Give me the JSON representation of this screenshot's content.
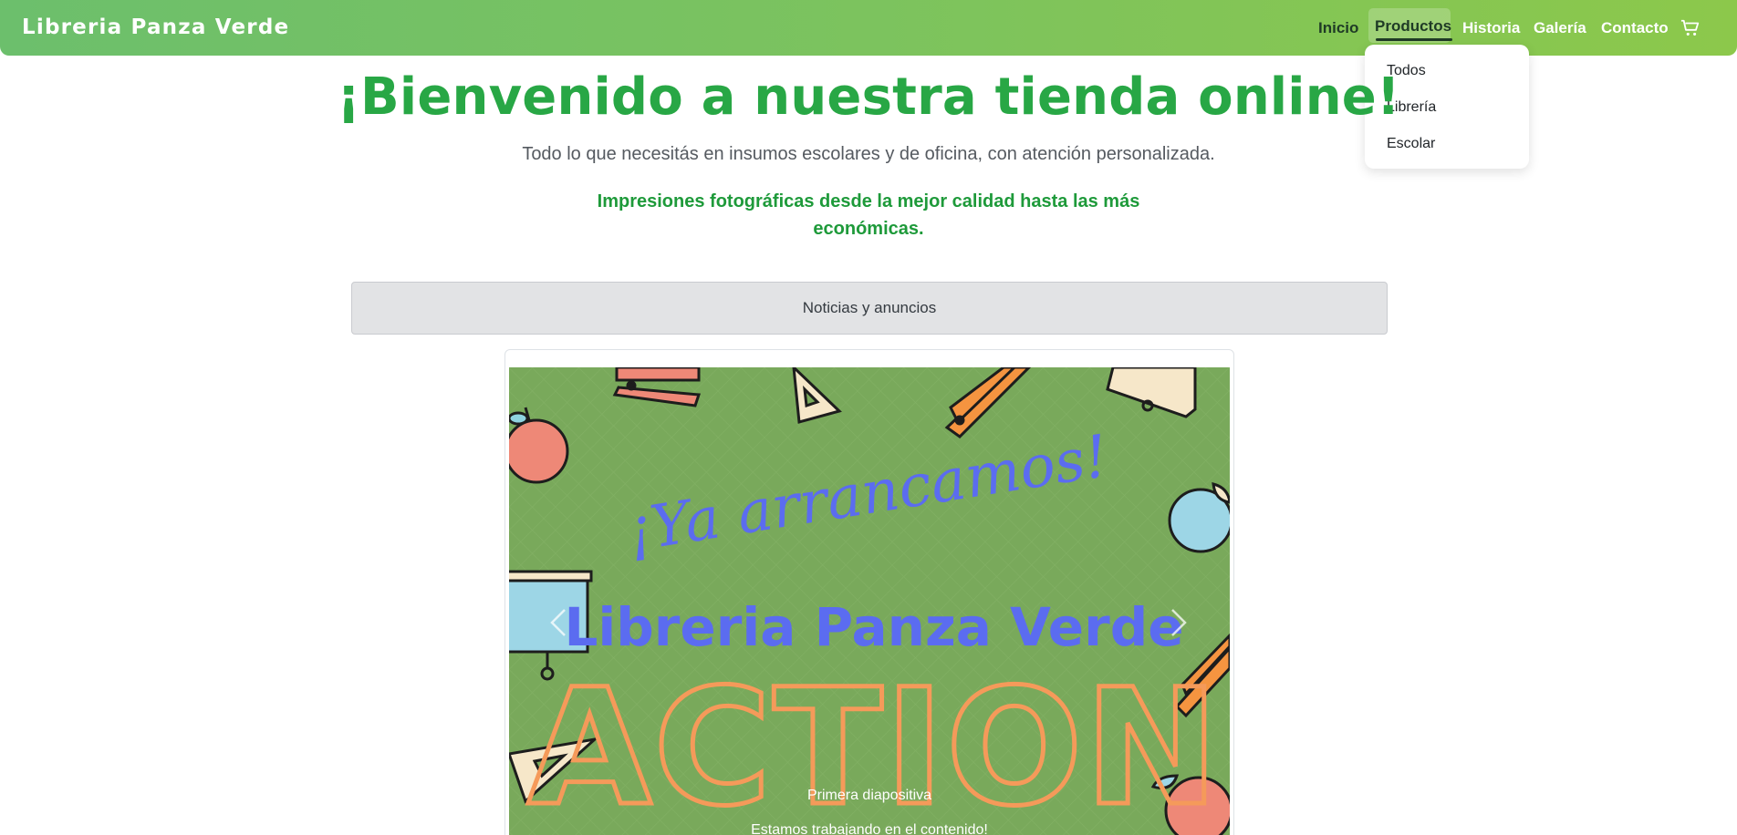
{
  "navbar": {
    "brand": "Libreria Panza Verde",
    "items": [
      {
        "label": "Inicio"
      },
      {
        "label": "Productos"
      },
      {
        "label": "Historia"
      },
      {
        "label": "Galería"
      },
      {
        "label": "Contacto"
      }
    ],
    "cart_icon": "cart-icon",
    "accent_start": "#6cbf6c",
    "accent_end": "#8cc84b"
  },
  "dropdown": {
    "items": [
      {
        "label": "Todos"
      },
      {
        "label": "Librería"
      },
      {
        "label": "Escolar"
      }
    ]
  },
  "hero": {
    "title": "¡Bienvenido a nuestra tienda online!",
    "subtitle": "Todo lo que necesitás en insumos escolares y de oficina, con atención personalizada.",
    "promo": "Impresiones fotográficas desde la mejor calidad hasta las más económicas.",
    "title_color": "#28a745"
  },
  "news": {
    "label": "Noticias y anuncios"
  },
  "carousel": {
    "slide": {
      "tagline": "¡Ya arrancamos!",
      "brand_text": "Libreria Panza Verde",
      "big_word": "ACTION",
      "background_color": "#79a95b"
    },
    "caption_title": "Primera diapositiva",
    "caption_text": "Estamos trabajando en el contenido!",
    "prev_icon": "chevron-left-icon",
    "next_icon": "chevron-right-icon"
  }
}
